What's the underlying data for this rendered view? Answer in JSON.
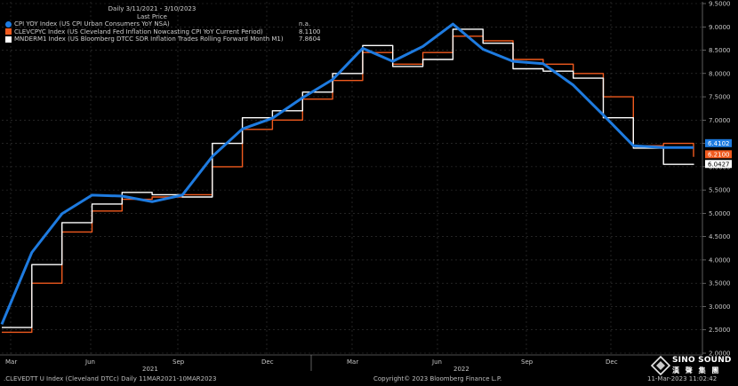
{
  "legend": {
    "period": "Daily 3/11/2021 - 3/10/2023",
    "subheader": "Last Price",
    "entries": [
      {
        "name": "CPI YOY Index (US CPI Urban Consumers YoY NSA)",
        "value": "n.a.",
        "color": "#1e7be0"
      },
      {
        "name": "CLEVCPYC Index (US Cleveland Fed Inflation Nowcasting CPI YoY Current Period)",
        "value": "8.1100",
        "color": "#f05a1e"
      },
      {
        "name": "MNDERM1 Index (US Bloomberg DTCC SDR Inflation Trades Rolling Forward Month M1)",
        "value": "7.8604",
        "color": "#ffffff"
      }
    ]
  },
  "footer": {
    "left": ".CLEVEDTT U Index (Cleveland DTCc)  Daily 11MAR2021-10MAR2023",
    "center": "Copyright© 2023 Bloomberg Finance L.P.",
    "right": "11-Mar-2023 11:02:42"
  },
  "logo": {
    "en": "SINO SOUND",
    "cn": "漢 聲 集 團"
  },
  "chart_data": {
    "type": "line",
    "y_ticks": [
      "2.0000",
      "2.5000",
      "3.0000",
      "3.5000",
      "4.0000",
      "4.5000",
      "5.0000",
      "5.5000",
      "6.0000",
      "6.5000",
      "7.0000",
      "7.5000",
      "8.0000",
      "8.5000",
      "9.0000",
      "9.5000"
    ],
    "ylim": [
      2.0,
      9.5
    ],
    "x_ticks": [
      "Mar",
      "Jun",
      "Sep",
      "Dec",
      "Mar",
      "Jun",
      "Sep",
      "Dec"
    ],
    "x_years": [
      "2021",
      "2022"
    ],
    "grid": true,
    "axis_side": "right",
    "last_value_labels": [
      {
        "value": "6.4102",
        "color": "#1e7be0"
      },
      {
        "value": "6.2100",
        "color": "#f05a1e"
      },
      {
        "value": "6.0427",
        "color": "#ffffff"
      }
    ],
    "series": [
      {
        "name": "CPI YOY Index",
        "color": "#1e7be0",
        "shape": "linear",
        "x": [
          0,
          1,
          2,
          3,
          4,
          5,
          6,
          7,
          8,
          9,
          10,
          11,
          12,
          13,
          14,
          15,
          16,
          17,
          18,
          19,
          20,
          21,
          22,
          23
        ],
        "y": [
          2.62,
          4.16,
          4.99,
          5.39,
          5.37,
          5.25,
          5.39,
          6.22,
          6.81,
          7.04,
          7.48,
          7.87,
          8.54,
          8.26,
          8.58,
          9.06,
          8.52,
          8.26,
          8.21,
          7.75,
          7.11,
          6.45,
          6.41,
          6.41
        ]
      },
      {
        "name": "CLEVCPYC Index",
        "color": "#f05a1e",
        "shape": "step",
        "x": [
          0,
          1,
          2,
          3,
          4,
          5,
          6,
          7,
          8,
          9,
          10,
          11,
          12,
          13,
          14,
          15,
          16,
          17,
          18,
          19,
          20,
          21,
          22,
          23
        ],
        "y": [
          2.45,
          3.5,
          4.6,
          5.05,
          5.3,
          5.35,
          5.4,
          6.0,
          6.8,
          7.0,
          7.45,
          7.85,
          8.45,
          8.2,
          8.45,
          8.8,
          8.7,
          8.3,
          8.2,
          8.0,
          7.5,
          6.45,
          6.5,
          6.21
        ]
      },
      {
        "name": "MNDERM1 Index",
        "color": "#ffffff",
        "shape": "step",
        "x": [
          0,
          1,
          2,
          3,
          4,
          5,
          6,
          7,
          8,
          9,
          10,
          11,
          12,
          13,
          14,
          15,
          16,
          17,
          18,
          19,
          20,
          21,
          22,
          23
        ],
        "y": [
          2.55,
          3.9,
          4.8,
          5.2,
          5.45,
          5.4,
          5.35,
          6.5,
          7.05,
          7.2,
          7.6,
          8.0,
          8.6,
          8.15,
          8.3,
          8.95,
          8.65,
          8.1,
          8.05,
          7.9,
          7.05,
          6.4,
          6.05,
          6.04
        ]
      }
    ]
  }
}
